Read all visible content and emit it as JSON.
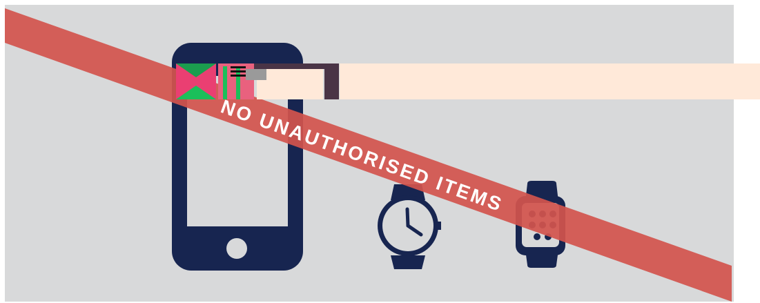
{
  "banner": {
    "stripe_text": "NO UNAUTHORISED ITEMS"
  },
  "icons": [
    "smartphone-icon",
    "analog-watch-icon",
    "smartwatch-icon"
  ],
  "colors": {
    "background": "#d8d9da",
    "icon_navy": "#172550",
    "stripe_red": "#d2544e",
    "stripe_text": "#ffffff",
    "overlay_peach": "#ffe9d9",
    "overlay_plum": "#4a3446"
  }
}
